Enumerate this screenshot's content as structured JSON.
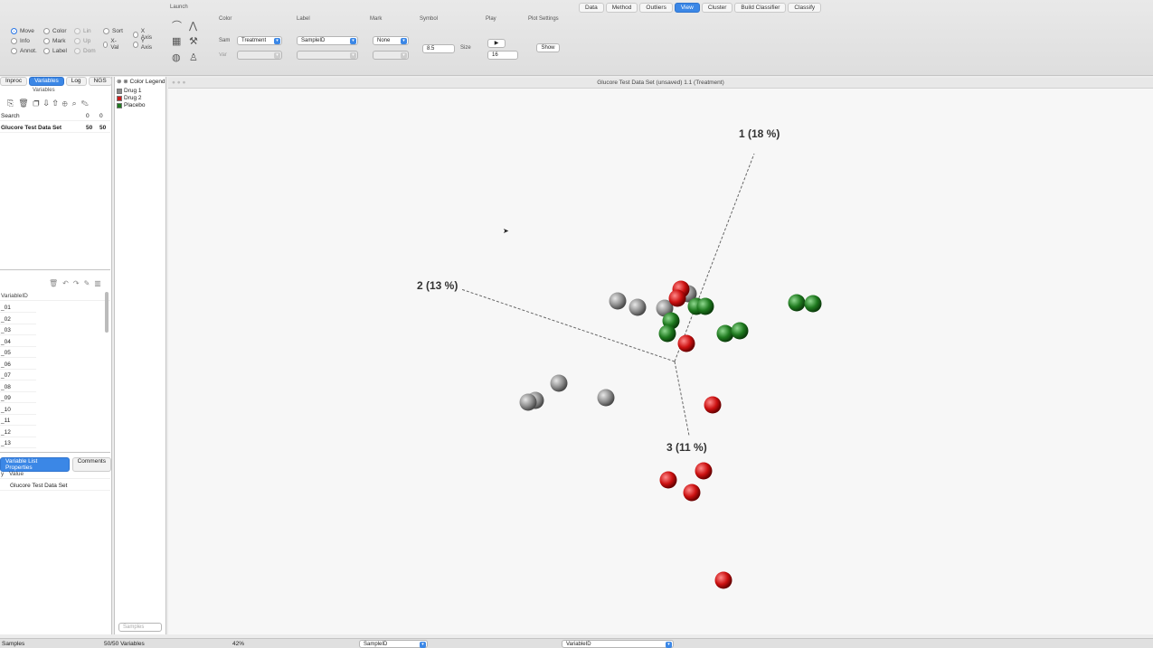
{
  "top_tabs": [
    "Data",
    "Method",
    "Outliers",
    "View",
    "Cluster",
    "Build Classifier",
    "Classify"
  ],
  "toolbar": {
    "launch_label": "Launch",
    "mode_radios": [
      {
        "label": "Move",
        "selected": true
      },
      {
        "label": "Info",
        "selected": false
      },
      {
        "label": "Annot.",
        "selected": false
      },
      {
        "label": "Color",
        "selected": false
      },
      {
        "label": "Mark",
        "selected": false
      },
      {
        "label": "Label",
        "selected": false
      },
      {
        "label": "Lin",
        "selected": false
      },
      {
        "label": "Up",
        "selected": false
      },
      {
        "label": "Dom",
        "selected": false
      },
      {
        "label": "Sort",
        "selected": false
      },
      {
        "label": "X-Val",
        "selected": false
      },
      {
        "label": "X Axis",
        "selected": false
      },
      {
        "label": "Y Axis",
        "selected": false
      }
    ],
    "color_group": {
      "title": "Color",
      "sam_label": "Sam",
      "sam_value": "Treatment",
      "var_label": "Var"
    },
    "label_group": {
      "title": "Label",
      "value": "SampleID"
    },
    "mark_group": {
      "title": "Mark",
      "value": "None"
    },
    "symbol_group": {
      "title": "Symbol",
      "size_value": "8.5",
      "size_label": "Size"
    },
    "play_group": {
      "title": "Play",
      "play_label": "▶",
      "value": "16"
    },
    "plot_settings": {
      "title": "Plot Settings",
      "button": "Show"
    }
  },
  "left_panel": {
    "tabs": [
      "Inproc",
      "Variables",
      "Log",
      "NGS"
    ],
    "section_title": "Variables",
    "search_label": "Search",
    "search_counts": [
      "0",
      "0"
    ],
    "dataset_row": {
      "name": "Glucore Test Data Set",
      "a": "50",
      "b": "50"
    },
    "var_header": "VariableID",
    "variables": [
      "_01",
      "_02",
      "_03",
      "_04",
      "_05",
      "_06",
      "_07",
      "_08",
      "_09",
      "_10",
      "_11",
      "_12",
      "_13"
    ],
    "props_tabs": [
      "Variable List Properties",
      "Comments"
    ],
    "props_header": [
      "y",
      "Value"
    ],
    "props_value": "Glucore Test Data Set"
  },
  "legend": {
    "title": "Color Legend",
    "items": [
      {
        "label": "Drug 1",
        "color": "#8a8a8a"
      },
      {
        "label": "Drug 2",
        "color": "#cc1a1a"
      },
      {
        "label": "Placebo",
        "color": "#1f7a1f"
      }
    ],
    "footer": "Samples"
  },
  "plot": {
    "window_title": "Glucore Test Data Set (unsaved) 1.1 (Treatment)",
    "axes": [
      {
        "label": "1 (18 %)"
      },
      {
        "label": "2 (13 %)"
      },
      {
        "label": "3 (11 %)"
      }
    ],
    "colors": {
      "gray": "#8f8f8f",
      "red": "#cc1111",
      "green": "#1f7a1f"
    },
    "points": [
      {
        "group": "gray"
      },
      {
        "group": "gray"
      },
      {
        "group": "gray"
      },
      {
        "group": "gray"
      },
      {
        "group": "gray"
      },
      {
        "group": "gray"
      },
      {
        "group": "gray"
      },
      {
        "group": "gray"
      },
      {
        "group": "red"
      },
      {
        "group": "red"
      },
      {
        "group": "red"
      },
      {
        "group": "red"
      },
      {
        "group": "red"
      },
      {
        "group": "red"
      },
      {
        "group": "red"
      },
      {
        "group": "red"
      },
      {
        "group": "green"
      },
      {
        "group": "green"
      },
      {
        "group": "green"
      },
      {
        "group": "green"
      },
      {
        "group": "green"
      },
      {
        "group": "green"
      },
      {
        "group": "green"
      },
      {
        "group": "green"
      }
    ]
  },
  "status_bar": {
    "samples_label": "Samples",
    "variables_label": "50/50 Variables",
    "zoom": "42%",
    "sample_select": "SampleID",
    "variable_select": "VariableID"
  }
}
